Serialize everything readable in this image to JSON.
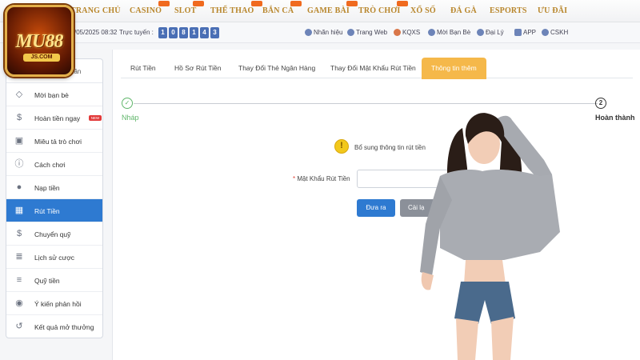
{
  "nav": {
    "items": [
      {
        "label": "TRANG CHỦ",
        "hot": false
      },
      {
        "label": "CASINO",
        "hot": true
      },
      {
        "label": "SLOT",
        "hot": true
      },
      {
        "label": "THỂ THAO",
        "hot": true
      },
      {
        "label": "BẮN CÁ",
        "hot": true
      },
      {
        "label": "GAME BÀI",
        "hot": true
      },
      {
        "label": "TRÒ CHƠI",
        "hot": true
      },
      {
        "label": "XỔ SỐ",
        "hot": false
      },
      {
        "label": "ĐÁ GÀ",
        "hot": false
      },
      {
        "label": "ESPORTS",
        "hot": false
      },
      {
        "label": "ƯU ĐÃI",
        "hot": false
      }
    ]
  },
  "logo": {
    "text": "MU88",
    "sub": "JS.COM"
  },
  "infobar": {
    "date": "/05/2025 08:32",
    "online_label": "Trực tuyến :",
    "online_digits": [
      "1",
      "0",
      "8",
      "1",
      "4",
      "3"
    ],
    "links": [
      {
        "label": "Nhãn hiệu",
        "icon": "brand-icon"
      },
      {
        "label": "Trang Web",
        "icon": "globe-icon"
      },
      {
        "label": "KQXS",
        "icon": "fire-icon"
      },
      {
        "label": "Mời Bạn Bè",
        "icon": "users-icon"
      },
      {
        "label": "Đại Lý",
        "icon": "heart-icon"
      },
      {
        "label": "APP",
        "icon": "phone-icon"
      },
      {
        "label": "CSKH",
        "icon": "support-icon"
      }
    ]
  },
  "sidebar": {
    "header_text": "hân",
    "items": [
      {
        "label": "Mời bạn bè",
        "icon": "diamond-icon",
        "glyph": "◇",
        "active": false,
        "badge": ""
      },
      {
        "label": "Hoàn tiền ngay",
        "icon": "coin-icon",
        "glyph": "$",
        "active": false,
        "badge": "NEW"
      },
      {
        "label": "Miêu tả trò chơi",
        "icon": "gamepad-icon",
        "glyph": "▣",
        "active": false,
        "badge": ""
      },
      {
        "label": "Cách chơi",
        "icon": "info-icon",
        "glyph": "ⓘ",
        "active": false,
        "badge": ""
      },
      {
        "label": "Nạp tiền",
        "icon": "piggy-bank-icon",
        "glyph": "●",
        "active": false,
        "badge": ""
      },
      {
        "label": "Rút Tiền",
        "icon": "withdraw-icon",
        "glyph": "▦",
        "active": true,
        "badge": ""
      },
      {
        "label": "Chuyển quỹ",
        "icon": "transfer-icon",
        "glyph": "$",
        "active": false,
        "badge": ""
      },
      {
        "label": "Lịch sử cược",
        "icon": "history-doc-icon",
        "glyph": "≣",
        "active": false,
        "badge": ""
      },
      {
        "label": "Quỹ tiền",
        "icon": "cash-icon",
        "glyph": "≡",
        "active": false,
        "badge": ""
      },
      {
        "label": "Ý kiến phản hồi",
        "icon": "chat-icon",
        "glyph": "◉",
        "active": false,
        "badge": ""
      },
      {
        "label": "Kết quả mở thưởng",
        "icon": "clock-history-icon",
        "glyph": "↺",
        "active": false,
        "badge": ""
      }
    ]
  },
  "tabs": [
    {
      "label": "Rút Tiền",
      "active": false
    },
    {
      "label": "Hồ Sơ Rút Tiền",
      "active": false
    },
    {
      "label": "Thay Đổi Thẻ Ngân Hàng",
      "active": false
    },
    {
      "label": "Thay Đổi Mật Khẩu Rút Tiền",
      "active": false
    },
    {
      "label": "Thông tin thêm",
      "active": true
    }
  ],
  "steps": {
    "start_label": "Nháp",
    "start_mark": "✓",
    "end_number": "2",
    "end_label": "Hoàn thành"
  },
  "notice": {
    "icon": "!",
    "text": "Bổ sung thông tin rút tiền"
  },
  "form": {
    "required_mark": "*",
    "password_label": "Mật Khẩu Rút Tiền",
    "password_value": ""
  },
  "buttons": {
    "submit": "Đưa ra",
    "reset": "Cài lạ"
  },
  "colors": {
    "accent": "#2e7ad1",
    "tab_active": "#f5b84a",
    "nav_text": "#b8862b",
    "success": "#5fb66a"
  }
}
